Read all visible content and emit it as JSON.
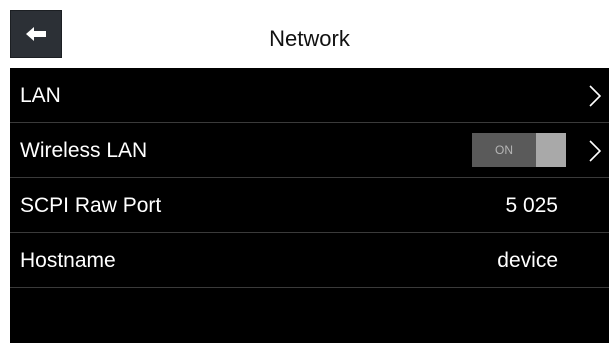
{
  "header": {
    "title": "Network",
    "back_icon": "arrow-left-icon"
  },
  "rows": [
    {
      "label": "LAN",
      "value": "",
      "control": "chevron-right-icon"
    },
    {
      "label": "Wireless LAN",
      "value": "",
      "toggle_text": "ON",
      "toggle_state": "on",
      "control": "chevron-right-icon"
    },
    {
      "label": "SCPI Raw Port",
      "value": "5 025"
    },
    {
      "label": "Hostname",
      "value": "device"
    }
  ],
  "colors": {
    "background": "#000000",
    "header_background": "#ffffff",
    "back_button": "#2c3036",
    "toggle_track": "#5a5a5a",
    "toggle_knob": "#a9a9a9"
  }
}
